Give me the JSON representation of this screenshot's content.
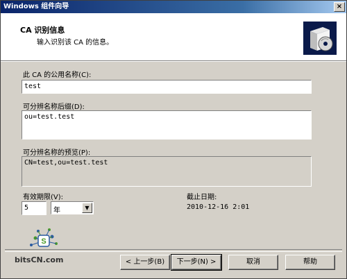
{
  "window": {
    "title": "Windows 组件向导",
    "close_glyph": "×"
  },
  "header": {
    "title": "CA 识别信息",
    "subtitle": "输入识别该 CA 的信息。"
  },
  "form": {
    "common_name_label": "此 CA 的公用名称(C):",
    "common_name_value": "test",
    "dn_suffix_label": "可分辨名称后缀(D):",
    "dn_suffix_value": "ou=test.test",
    "dn_preview_label": "可分辨名称的预览(P):",
    "dn_preview_value": "CN=test,ou=test.test",
    "validity_label": "有效期限(V):",
    "validity_value": "5",
    "validity_unit": "年",
    "expiry_label": "截止日期:",
    "expiry_value": "2010-12-16 2:01"
  },
  "buttons": {
    "back": "< 上一步(B)",
    "next": "下一步(N) >",
    "cancel": "取消",
    "help": "帮助"
  },
  "watermark": {
    "text": "bitsCN.com"
  },
  "colors": {
    "titlebar_start": "#0a246a",
    "titlebar_end": "#a6caf0",
    "logo_green": "#4a9a2a",
    "logo_blue": "#2a5aa0"
  }
}
